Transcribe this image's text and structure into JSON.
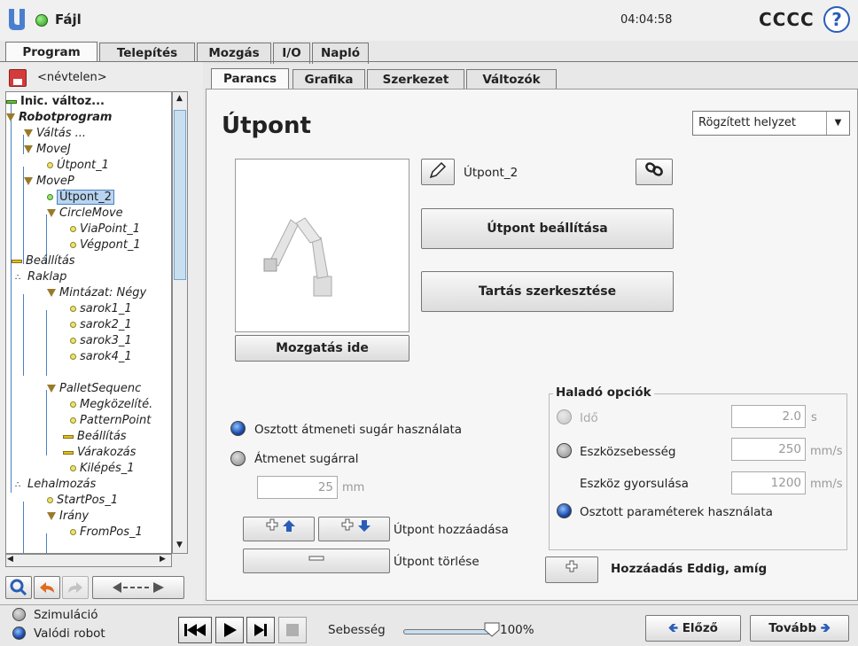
{
  "header": {
    "file_menu": "Fájl",
    "clock": "04:04:58",
    "robot_name": "CCCC",
    "help": "?"
  },
  "main_tabs": [
    "Program",
    "Telepítés",
    "Mozgás",
    "I/O",
    "Napló"
  ],
  "program": {
    "name": "<névtelen>"
  },
  "tree": {
    "items": [
      {
        "label": "Inic. változ...",
        "style": "bold",
        "icon": "var-init-icon"
      },
      {
        "label": "Robotprogram",
        "style": "bold-italic",
        "icon": "triangle-icon"
      },
      {
        "label": "Váltás ...",
        "style": "italic",
        "icon": "triangle-icon"
      },
      {
        "label": "MoveJ",
        "style": "italic",
        "icon": "triangle-icon"
      },
      {
        "label": "Útpont_1",
        "style": "italic",
        "icon": "waypoint-icon"
      },
      {
        "label": "MoveP",
        "style": "italic",
        "icon": "triangle-icon"
      },
      {
        "label": "Útpont_2",
        "style": "selected",
        "icon": "waypoint-icon"
      },
      {
        "label": "CircleMove",
        "style": "italic",
        "icon": "triangle-icon"
      },
      {
        "label": "ViaPoint_1",
        "style": "italic",
        "icon": "waypoint-icon"
      },
      {
        "label": "Végpont_1",
        "style": "italic",
        "icon": "waypoint-icon"
      },
      {
        "label": "Beállítás",
        "style": "italic",
        "icon": "dash-icon"
      },
      {
        "label": "Raklap",
        "style": "italic",
        "icon": "pallet-icon"
      },
      {
        "label": "Mintázat: Négy",
        "style": "italic",
        "icon": "triangle-icon"
      },
      {
        "label": "sarok1_1",
        "style": "italic",
        "icon": "waypoint-icon"
      },
      {
        "label": "sarok2_1",
        "style": "italic",
        "icon": "waypoint-icon"
      },
      {
        "label": "sarok3_1",
        "style": "italic",
        "icon": "waypoint-icon"
      },
      {
        "label": "sarok4_1",
        "style": "italic",
        "icon": "waypoint-icon"
      },
      {
        "label": "PalletSequenc",
        "style": "italic",
        "icon": "triangle-icon"
      },
      {
        "label": "Megközelíté.",
        "style": "italic",
        "icon": "waypoint-icon"
      },
      {
        "label": "PatternPoint",
        "style": "italic",
        "icon": "waypoint-icon"
      },
      {
        "label": "Beállítás",
        "style": "italic",
        "icon": "dash-icon"
      },
      {
        "label": "Várakozás",
        "style": "italic",
        "icon": "dash-icon"
      },
      {
        "label": "Kilépés_1",
        "style": "italic",
        "icon": "waypoint-icon"
      },
      {
        "label": "Lehalmozás",
        "style": "italic",
        "icon": "pallet-icon"
      },
      {
        "label": "StartPos_1",
        "style": "italic",
        "icon": "waypoint-icon"
      },
      {
        "label": "Irány",
        "style": "italic",
        "icon": "triangle-icon"
      },
      {
        "label": "FromPos_1",
        "style": "italic",
        "icon": "waypoint-icon"
      }
    ]
  },
  "sub_tabs": [
    "Parancs",
    "Grafika",
    "Szerkezet",
    "Változók"
  ],
  "waypoint": {
    "title": "Útpont",
    "position_type": "Rögzített helyzet",
    "name": "Útpont_2",
    "set_button": "Útpont beállítása",
    "edit_pose_button": "Tartás szerkesztése",
    "move_here_button": "Mozgatás ide",
    "shared_blend_label": "Osztott átmeneti sugár használata",
    "blend_radius_label": "Átmenet sugárral",
    "blend_value": "25",
    "blend_unit": "mm",
    "add_waypoint_label": "Útpont hozzáadása",
    "delete_waypoint_label": "Útpont törlése",
    "add_until_label": "Hozzáadás Eddig, amíg"
  },
  "advanced": {
    "title": "Haladó opciók",
    "time_label": "Idő",
    "time_value": "2.0",
    "time_unit": "s",
    "tool_speed_label": "Eszközsebesség",
    "tool_speed_value": "250",
    "tool_speed_unit": "mm/s",
    "tool_accel_label": "Eszköz gyorsulása",
    "tool_accel_value": "1200",
    "tool_accel_unit": "mm/s",
    "shared_params_label": "Osztott paraméterek használata"
  },
  "footer": {
    "simulation_label": "Szimuláció",
    "real_robot_label": "Valódi robot",
    "speed_label": "Sebesség",
    "speed_value": "100%",
    "speed_fraction": 1.0,
    "prev_button": "Előző",
    "next_button": "Tovább"
  },
  "colors": {
    "accent_blue": "#2a5db8",
    "selection": "#b8d4f0",
    "status_green": "#2a9a1a"
  }
}
